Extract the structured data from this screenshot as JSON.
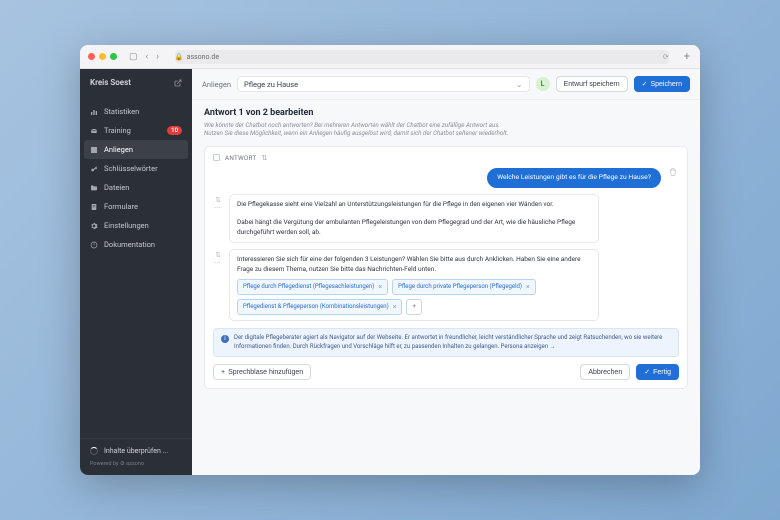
{
  "browser": {
    "url": "assono.de",
    "lock_icon": "lock"
  },
  "sidebar": {
    "title": "Kreis Soest",
    "items": [
      {
        "icon": "stats",
        "label": "Statistiken"
      },
      {
        "icon": "training",
        "label": "Training",
        "badge": "10"
      },
      {
        "icon": "anliegen",
        "label": "Anliegen",
        "active": true
      },
      {
        "icon": "key",
        "label": "Schlüsselwörter"
      },
      {
        "icon": "folder",
        "label": "Dateien"
      },
      {
        "icon": "form",
        "label": "Formulare"
      },
      {
        "icon": "gear",
        "label": "Einstellungen"
      },
      {
        "icon": "doc",
        "label": "Dokumentation"
      }
    ],
    "footer": {
      "check_label": "Inhalte überprüfen ...",
      "powered": "Powered by ⚙ assono"
    }
  },
  "topbar": {
    "label": "Anliegen",
    "select_value": "Pflege zu Hause",
    "avatar": "L",
    "draft_btn": "Entwurf speichern",
    "save_btn": "Speichern"
  },
  "content": {
    "heading": "Antwort 1 von 2 bearbeiten",
    "subtext": "Wie könnte der Chatbot noch antworten? Bei mehreren Antworten wählt der Chatbot eine zufällige Antwort aus.\nNutzen Sie diese Möglichkeit, wenn ein Anliegen häufig ausgelöst wird, damit sich der Chatbot seltener wiederholt.",
    "card_label": "ANTWORT",
    "user_bubble": "Welche Leistungen gibt es für die Pflege zu Hause?",
    "bot_bubble_1": "Die Pflegekasse sieht eine Vielzahl an Unterstützungsleistungen für die Pflege in den eigenen vier Wänden vor.\n\nDabei hängt die Vergütung der ambulanten Pflegeleistungen von dem Pflegegrad und der Art, wie die häusliche Pflege durchgeführt werden soll, ab.",
    "bot_bubble_2": "Interessieren Sie sich für eine der folgenden 3 Leistungen? Wählen Sie bitte aus durch Anklicken. Haben Sie eine andere Frage zu diesem Thema, nutzen Sie bitte das Nachrichten-Feld unten.",
    "chips": [
      "Pflege durch Pflegedienst (Pflegesachleistungen)",
      "Pflege durch private Pflegeperson (Pflegegeld)",
      "Pflegedienst & Pflegeperson (Kombinationsleistungen)"
    ],
    "info_banner": "Der digitale Pflegeberater agiert als Navigator auf der Webseite. Er antwortet in freundlicher, leicht verständlicher Sprache und zeigt Ratsuchenden, wo sie weitere Informationen finden. Durch Rückfragen und Vorschläge hilft er, zu passenden Inhalten zu gelangen.   Persona anzeigen →",
    "footer": {
      "add_bubble": "Sprechblase hinzufügen",
      "cancel": "Abbrechen",
      "done": "Fertig"
    }
  }
}
